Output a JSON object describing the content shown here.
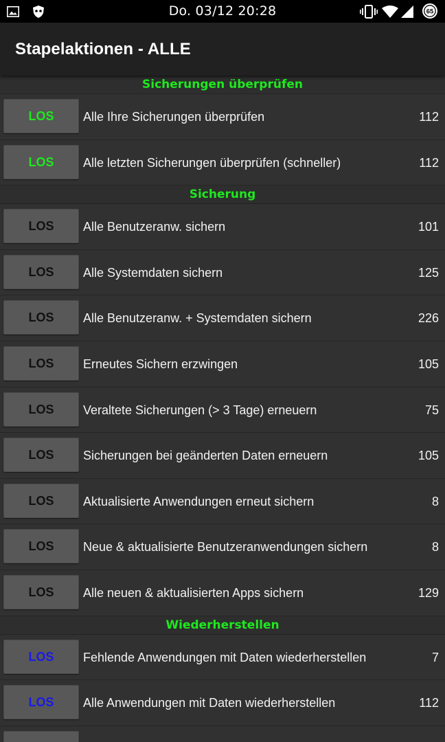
{
  "status_bar": {
    "clock": "Do. 03/12 20:28",
    "battery_level": "65",
    "left_icons": [
      "image-icon",
      "shield-app-icon"
    ],
    "right_icons": [
      "vibrate-icon",
      "wifi-icon",
      "signal-icon",
      "battery-icon"
    ]
  },
  "app_bar": {
    "title": "Stapelaktionen - ALLE"
  },
  "colors": {
    "accent_green": "#1fe81f",
    "restore_blue": "#1a1ae8",
    "background": "#313131",
    "app_bar": "#212121"
  },
  "sections": [
    {
      "header": "Sicherungen überprüfen",
      "button_color": "green",
      "rows": [
        {
          "button": "LOS",
          "label": "Alle Ihre Sicherungen überprüfen",
          "count": "112"
        },
        {
          "button": "LOS",
          "label": "Alle letzten Sicherungen überprüfen (schneller)",
          "count": "112"
        }
      ]
    },
    {
      "header": "Sicherung",
      "button_color": "black",
      "rows": [
        {
          "button": "LOS",
          "label": "Alle Benutzeranw. sichern",
          "count": "101"
        },
        {
          "button": "LOS",
          "label": "Alle Systemdaten sichern",
          "count": "125"
        },
        {
          "button": "LOS",
          "label": "Alle Benutzeranw. + Systemdaten sichern",
          "count": "226"
        },
        {
          "button": "LOS",
          "label": "Erneutes Sichern erzwingen",
          "count": "105"
        },
        {
          "button": "LOS",
          "label": "Veraltete Sicherungen (> 3 Tage) erneuern",
          "count": "75"
        },
        {
          "button": "LOS",
          "label": "Sicherungen bei geänderten Daten erneuern",
          "count": "105"
        },
        {
          "button": "LOS",
          "label": "Aktualisierte Anwendungen erneut sichern",
          "count": "8"
        },
        {
          "button": "LOS",
          "label": "Neue & aktualisierte Benutzeranwendungen sichern",
          "count": "8"
        },
        {
          "button": "LOS",
          "label": "Alle neuen & aktualisierten Apps sichern",
          "count": "129"
        }
      ]
    },
    {
      "header": "Wiederherstellen",
      "button_color": "blue",
      "rows": [
        {
          "button": "LOS",
          "label": "Fehlende Anwendungen mit Daten wiederherstellen",
          "count": "7"
        },
        {
          "button": "LOS",
          "label": "Alle Anwendungen mit Daten wiederherstellen",
          "count": "112"
        },
        {
          "button": "",
          "label": "",
          "count": ""
        }
      ]
    }
  ]
}
